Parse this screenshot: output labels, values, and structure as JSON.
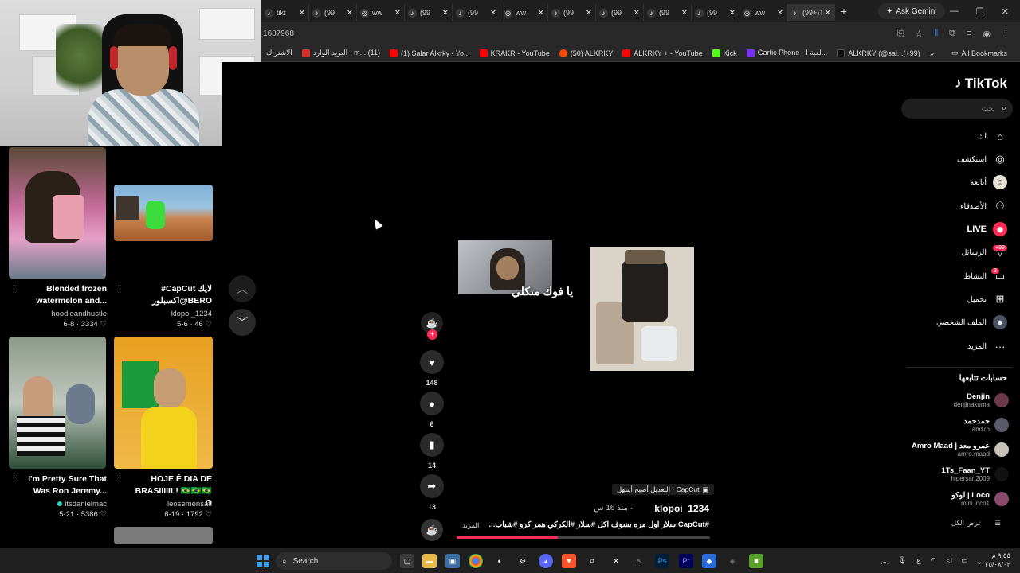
{
  "browser": {
    "tabs": [
      {
        "title": "tikt",
        "icon": "tiktok-icon"
      },
      {
        "title": "(99",
        "icon": "tiktok-icon"
      },
      {
        "title": "ww",
        "icon": "globe-icon"
      },
      {
        "title": "(99",
        "icon": "tiktok-icon"
      },
      {
        "title": "(99",
        "icon": "tiktok-icon"
      },
      {
        "title": "ww",
        "icon": "globe-icon"
      },
      {
        "title": "(99",
        "icon": "tiktok-icon"
      },
      {
        "title": "(99",
        "icon": "tiktok-icon"
      },
      {
        "title": "(99",
        "icon": "tiktok-icon"
      },
      {
        "title": "(99",
        "icon": "tiktok-icon"
      },
      {
        "title": "ww",
        "icon": "globe-icon"
      },
      {
        "title": "(99+)Ti",
        "icon": "tiktok-icon"
      }
    ],
    "ask_gemini": "Ask Gemini",
    "url": "1687968",
    "bookmarks": [
      {
        "label": "الاشتراك",
        "color": "#282828"
      },
      {
        "label": "البريد الوارد - m... (11)",
        "color": "#d93025"
      },
      {
        "label": "(1) Salar Alkrky - Yo...",
        "color": "#ff0000"
      },
      {
        "label": "KRAKR - YouTube",
        "color": "#ff0000"
      },
      {
        "label": "(50) ALKRKY",
        "color": "#ff4500"
      },
      {
        "label": "ALKRKY + - YouTube",
        "color": "#ff0000"
      },
      {
        "label": "Kick",
        "color": "#53fc18"
      },
      {
        "label": "Gartic Phone - لعبة ا...",
        "color": "#7b2ff7"
      },
      {
        "label": "ALKRKY (@sal...(+99)",
        "color": "#111111"
      }
    ],
    "all_bookmarks": "All Bookmarks"
  },
  "feed": {
    "cards": [
      {
        "title": "Blended frozen watermelon and...",
        "user": "hoodieandhustle",
        "stats": "6-8 · 3334 ♡"
      },
      {
        "title": "#CapCut لايك اكسبلور@BERO",
        "user": "klopoi_1234",
        "stats": "5-6 · 46 ♡"
      },
      {
        "title": "I'm Pretty Sure That Was Ron Jeremy...",
        "user": "itsdanielmac",
        "stats": "5-21 · 5386 ♡"
      },
      {
        "title": "HOJE É DIA DE BRASIIIIIL! 🇧🇷🇧🇷🇧🇷 O",
        "user": "leosemensati",
        "stats": "6-19 · 1792 ♡"
      }
    ]
  },
  "video": {
    "overlay_text": "يا فوك متكلي",
    "likes": "148",
    "comments": "6",
    "saves": "14",
    "shares": "13",
    "capcut_label": "CapCut · التعديل أصبح أسهل",
    "author": "klopoi_1234",
    "since": "· منذ 16 س",
    "description": "#CapCut سلار اول مره يشوف اكل #سلار #الكركي همر كرو #شباب...",
    "more": "المزيد",
    "progress": 0.4
  },
  "sidebar": {
    "logo": "TikTok",
    "search_placeholder": "بحث",
    "nav": [
      {
        "label": "لك",
        "icon": "home-icon"
      },
      {
        "label": "استكشف",
        "icon": "compass-icon"
      },
      {
        "label": "أتابعه",
        "icon": "following-icon"
      },
      {
        "label": "الأصدقاء",
        "icon": "friends-icon"
      },
      {
        "label": "LIVE",
        "icon": "live-icon"
      },
      {
        "label": "الرسائل",
        "icon": "inbox-icon",
        "badge": "+99"
      },
      {
        "label": "النشاط",
        "icon": "activity-icon",
        "badge": "3"
      },
      {
        "label": "تحميل",
        "icon": "upload-icon"
      },
      {
        "label": "الملف الشخصي",
        "icon": "profile-icon"
      },
      {
        "label": "المزيد",
        "icon": "more-icon"
      }
    ],
    "following_header": "حسابات تتابعها",
    "following": [
      {
        "name": "Denjin",
        "handle": "denjinakuma"
      },
      {
        "name": "حمدحمد",
        "handle": "ahd7o"
      },
      {
        "name": "Amro Maad | عمرو معد",
        "handle": "amro.maad"
      },
      {
        "name": "1Ts_Faan_YT",
        "handle": "hidersan2009"
      },
      {
        "name": "لوكو | Loco",
        "handle": "mini.loco1"
      }
    ],
    "see_all": "عرض الكل"
  },
  "taskbar": {
    "search": "Search",
    "lang": "ع",
    "time": "٩:٥٥ م",
    "date": "٢٠٢٥/٠٨/٠٢"
  }
}
